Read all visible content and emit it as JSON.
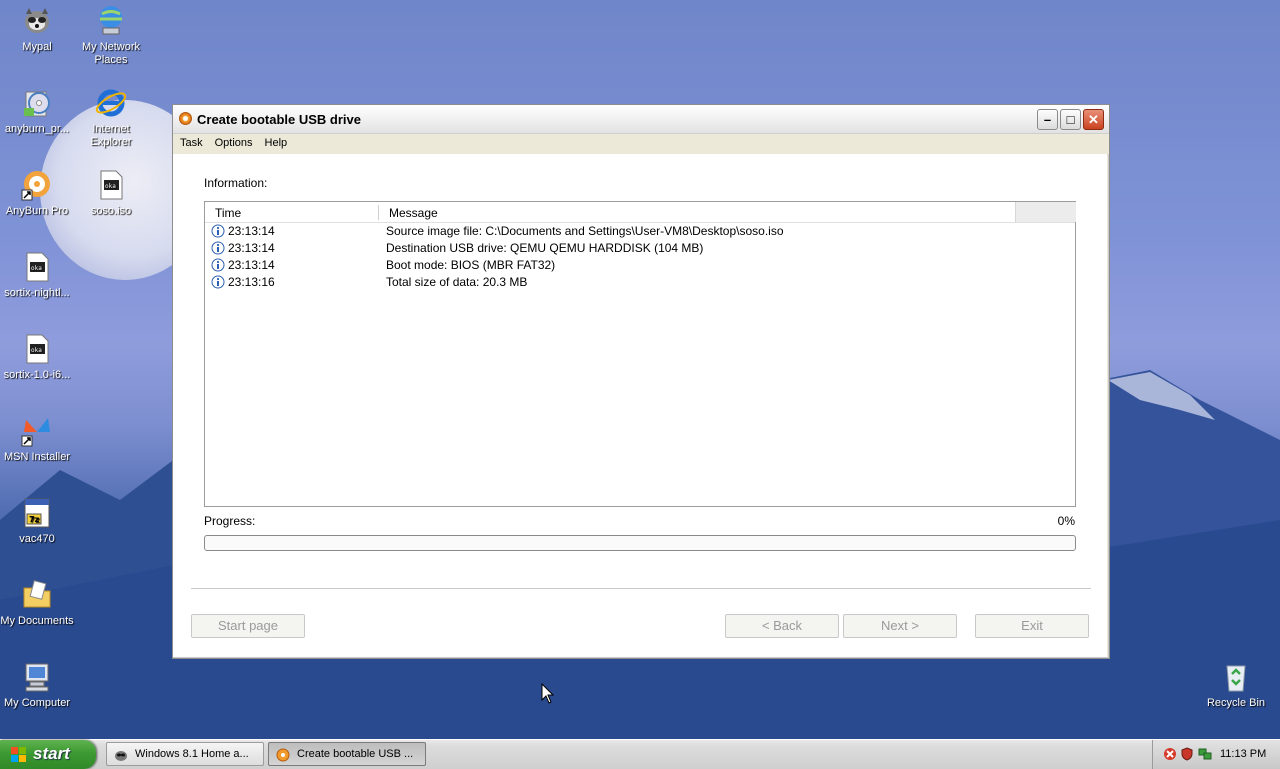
{
  "desktop": {
    "icons": [
      {
        "label": "Mypal",
        "icon": "raccoon-icon"
      },
      {
        "label": "My Network Places",
        "icon": "network-places-icon"
      },
      {
        "label": "anyburn_pr...",
        "icon": "installer-cd-icon"
      },
      {
        "label": "Internet Explorer",
        "icon": "internet-explorer-icon"
      },
      {
        "label": "AnyBurn Pro",
        "icon": "anyburn-disc-icon"
      },
      {
        "label": "soso.iso",
        "icon": "iso-file-icon"
      },
      {
        "label": "sortix-nightl...",
        "icon": "iso-file-icon"
      },
      {
        "label": "sortix-1.0-i6...",
        "icon": "iso-file-icon"
      },
      {
        "label": "MSN Installer",
        "icon": "msn-butterfly-icon"
      },
      {
        "label": "vac470",
        "icon": "7zip-archive-icon"
      },
      {
        "label": "My Documents",
        "icon": "my-documents-icon"
      },
      {
        "label": "My Computer",
        "icon": "my-computer-icon"
      },
      {
        "label": "Recycle Bin",
        "icon": "recycle-bin-icon"
      }
    ]
  },
  "window": {
    "title": "Create bootable USB drive",
    "menu": [
      "Task",
      "Options",
      "Help"
    ],
    "info_label": "Information:",
    "columns": {
      "time": "Time",
      "message": "Message"
    },
    "log": [
      {
        "time": "23:13:14",
        "message": "Source image file: C:\\Documents and Settings\\User-VM8\\Desktop\\soso.iso"
      },
      {
        "time": "23:13:14",
        "message": "Destination USB drive: QEMU QEMU HARDDISK (104 MB)"
      },
      {
        "time": "23:13:14",
        "message": "Boot mode: BIOS (MBR FAT32)"
      },
      {
        "time": "23:13:16",
        "message": "Total size of data: 20.3 MB"
      }
    ],
    "progress": {
      "label": "Progress:",
      "percent_text": "0%",
      "value": 0
    },
    "buttons": {
      "start_page": "Start page",
      "back": "< Back",
      "next": "Next >",
      "exit": "Exit"
    }
  },
  "taskbar": {
    "start_label": "start",
    "tasks": [
      {
        "label": "Windows 8.1 Home a...",
        "active": false
      },
      {
        "label": "Create bootable USB ...",
        "active": true
      }
    ],
    "clock": "11:13 PM"
  }
}
